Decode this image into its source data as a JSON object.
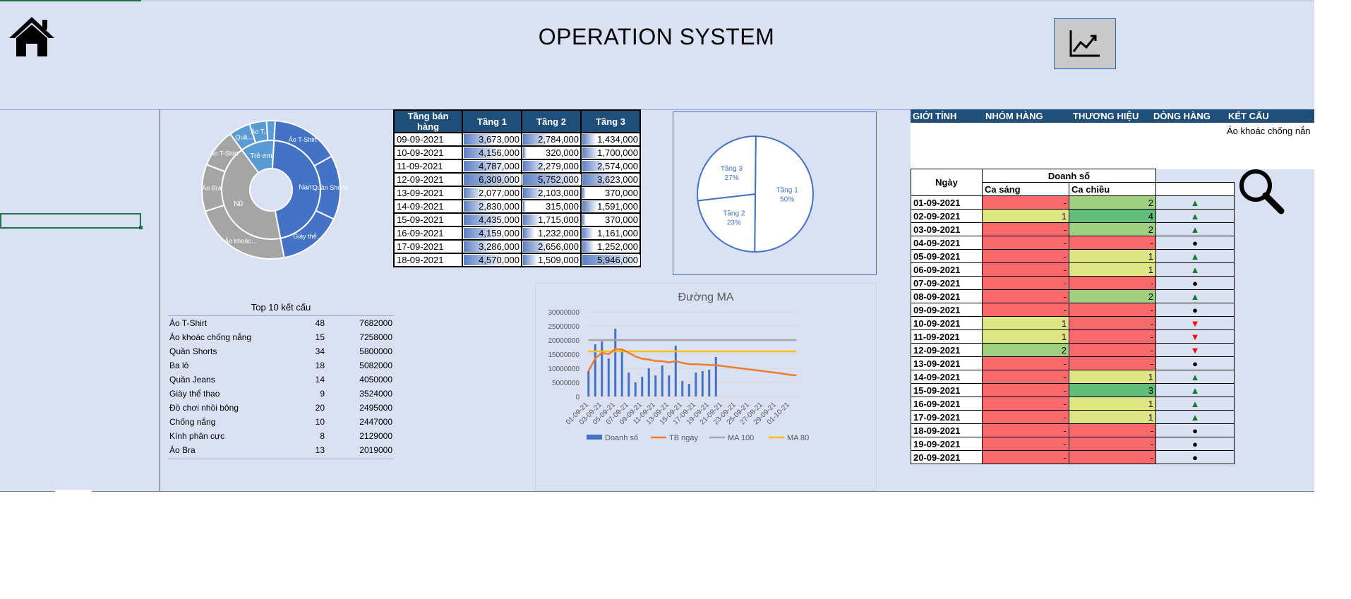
{
  "app": {
    "title": "OPERATION SYSTEM"
  },
  "icons": {
    "home": "home-icon",
    "chart": "chart-line-icon",
    "search": "search-icon"
  },
  "floor_table": {
    "headers": [
      "Tầng bán hàng",
      "Tầng 1",
      "Tầng 2",
      "Tầng 3"
    ],
    "rows": [
      {
        "date": "09-09-2021",
        "t1": "3,673,000",
        "t2": "2,784,000",
        "t3": "1,434,000",
        "f1": 0.58,
        "f2": 0.48,
        "f3": 0.24
      },
      {
        "date": "10-09-2021",
        "t1": "4,156,000",
        "t2": "320,000",
        "t3": "1,700,000",
        "f1": 0.66,
        "f2": 0.06,
        "f3": 0.29
      },
      {
        "date": "11-09-2021",
        "t1": "4,787,000",
        "t2": "2,279,000",
        "t3": "2,574,000",
        "f1": 0.76,
        "f2": 0.4,
        "f3": 0.43
      },
      {
        "date": "12-09-2021",
        "t1": "6,309,000",
        "t2": "5,752,000",
        "t3": "3,623,000",
        "f1": 1.0,
        "f2": 1.0,
        "f3": 0.61
      },
      {
        "date": "13-09-2021",
        "t1": "2,077,000",
        "t2": "2,103,000",
        "t3": "370,000",
        "f1": 0.33,
        "f2": 0.37,
        "f3": 0.06
      },
      {
        "date": "14-09-2021",
        "t1": "2,830,000",
        "t2": "315,000",
        "t3": "1,591,000",
        "f1": 0.45,
        "f2": 0.05,
        "f3": 0.27
      },
      {
        "date": "15-09-2021",
        "t1": "4,435,000",
        "t2": "1,715,000",
        "t3": "370,000",
        "f1": 0.7,
        "f2": 0.3,
        "f3": 0.06
      },
      {
        "date": "16-09-2021",
        "t1": "4,159,000",
        "t2": "1,232,000",
        "t3": "1,161,000",
        "f1": 0.66,
        "f2": 0.21,
        "f3": 0.2
      },
      {
        "date": "17-09-2021",
        "t1": "3,286,000",
        "t2": "2,656,000",
        "t3": "1,252,000",
        "f1": 0.52,
        "f2": 0.46,
        "f3": 0.21
      },
      {
        "date": "18-09-2021",
        "t1": "4,570,000",
        "t2": "1,509,000",
        "t3": "5,946,000",
        "f1": 0.72,
        "f2": 0.26,
        "f3": 1.0
      }
    ]
  },
  "filters": {
    "headers": [
      "GIỚI TÍNH",
      "NHÓM HÀNG",
      "THƯƠNG HIỆU",
      "DÒNG HÀNG",
      "KẾT CẤU"
    ],
    "value": "Áo khoác chống nắn"
  },
  "sales_table": {
    "date_header": "Ngày",
    "group_header": "Doanh số",
    "col1": "Ca sáng",
    "col2": "Ca chiều",
    "rows": [
      {
        "date": "01-09-2021",
        "a": "-",
        "b": "2",
        "ca": "red",
        "cb": "lgr",
        "trend": "▲",
        "tc": "up"
      },
      {
        "date": "02-09-2021",
        "a": "1",
        "b": "4",
        "ca": "yel",
        "cb": "grn",
        "trend": "▲",
        "tc": "up"
      },
      {
        "date": "03-09-2021",
        "a": "-",
        "b": "2",
        "ca": "red",
        "cb": "lgr",
        "trend": "▲",
        "tc": "up"
      },
      {
        "date": "04-09-2021",
        "a": "-",
        "b": "-",
        "ca": "red",
        "cb": "red",
        "trend": "●",
        "tc": "dot"
      },
      {
        "date": "05-09-2021",
        "a": "-",
        "b": "1",
        "ca": "red",
        "cb": "yel",
        "trend": "▲",
        "tc": "up"
      },
      {
        "date": "06-09-2021",
        "a": "-",
        "b": "1",
        "ca": "red",
        "cb": "yel",
        "trend": "▲",
        "tc": "up"
      },
      {
        "date": "07-09-2021",
        "a": "-",
        "b": "-",
        "ca": "red",
        "cb": "red",
        "trend": "●",
        "tc": "dot"
      },
      {
        "date": "08-09-2021",
        "a": "-",
        "b": "2",
        "ca": "red",
        "cb": "lgr",
        "trend": "▲",
        "tc": "up"
      },
      {
        "date": "09-09-2021",
        "a": "-",
        "b": "-",
        "ca": "red",
        "cb": "red",
        "trend": "●",
        "tc": "dot"
      },
      {
        "date": "10-09-2021",
        "a": "1",
        "b": "-",
        "ca": "yel",
        "cb": "red",
        "trend": "▼",
        "tc": "down"
      },
      {
        "date": "11-09-2021",
        "a": "1",
        "b": "-",
        "ca": "yel",
        "cb": "red",
        "trend": "▼",
        "tc": "down"
      },
      {
        "date": "12-09-2021",
        "a": "2",
        "b": "-",
        "ca": "lgr",
        "cb": "red",
        "trend": "▼",
        "tc": "down"
      },
      {
        "date": "13-09-2021",
        "a": "-",
        "b": "-",
        "ca": "red",
        "cb": "red",
        "trend": "●",
        "tc": "dot"
      },
      {
        "date": "14-09-2021",
        "a": "-",
        "b": "1",
        "ca": "red",
        "cb": "yel",
        "trend": "▲",
        "tc": "up"
      },
      {
        "date": "15-09-2021",
        "a": "-",
        "b": "3",
        "ca": "red",
        "cb": "grn",
        "trend": "▲",
        "tc": "up"
      },
      {
        "date": "16-09-2021",
        "a": "-",
        "b": "1",
        "ca": "red",
        "cb": "yel",
        "trend": "▲",
        "tc": "up"
      },
      {
        "date": "17-09-2021",
        "a": "-",
        "b": "1",
        "ca": "red",
        "cb": "yel",
        "trend": "▲",
        "tc": "up"
      },
      {
        "date": "18-09-2021",
        "a": "-",
        "b": "-",
        "ca": "red",
        "cb": "red",
        "trend": "●",
        "tc": "dot"
      },
      {
        "date": "19-09-2021",
        "a": "-",
        "b": "-",
        "ca": "red",
        "cb": "red",
        "trend": "●",
        "tc": "dot"
      },
      {
        "date": "20-09-2021",
        "a": "-",
        "b": "-",
        "ca": "red",
        "cb": "red",
        "trend": "●",
        "tc": "dot"
      }
    ]
  },
  "top10": {
    "title": "Top 10 kết cấu",
    "rows": [
      {
        "name": "Áo T-Shirt",
        "qty": "48",
        "sales": "7682000"
      },
      {
        "name": "Áo khoác chống nắng",
        "qty": "15",
        "sales": "7258000"
      },
      {
        "name": "Quần Shorts",
        "qty": "34",
        "sales": "5800000"
      },
      {
        "name": "Ba lô",
        "qty": "18",
        "sales": "5082000"
      },
      {
        "name": "Quần Jeans",
        "qty": "14",
        "sales": "4050000"
      },
      {
        "name": "Giày thể thao",
        "qty": "9",
        "sales": "3524000"
      },
      {
        "name": "Đồ chơi nhồi bông",
        "qty": "20",
        "sales": "2495000"
      },
      {
        "name": "Chống nắng",
        "qty": "10",
        "sales": "2447000"
      },
      {
        "name": "Kính phân cực",
        "qty": "8",
        "sales": "2129000"
      },
      {
        "name": "Áo Bra",
        "qty": "13",
        "sales": "2019000"
      }
    ]
  },
  "chart_data": [
    {
      "type": "sunburst",
      "inner": [
        {
          "label": "Nam",
          "value": 0.46,
          "color": "#4472c4"
        },
        {
          "label": "Nữ",
          "value": 0.43,
          "color": "#a5a5a5"
        },
        {
          "label": "Trẻ em",
          "value": 0.11,
          "color": "#5b9bd5"
        }
      ],
      "outer": [
        {
          "label": "Áo T-Shirt",
          "value": 0.16,
          "color": "#4472c4"
        },
        {
          "label": "Quần Shorts",
          "value": 0.15,
          "color": "#4472c4"
        },
        {
          "label": "Giày thể...",
          "value": 0.15,
          "color": "#4472c4"
        },
        {
          "label": "Áo khoác chống nắng",
          "value": 0.23,
          "color": "#a5a5a5"
        },
        {
          "label": "Áo Bra",
          "value": 0.11,
          "color": "#a5a5a5"
        },
        {
          "label": "Áo T-Shirt",
          "value": 0.09,
          "color": "#a5a5a5"
        },
        {
          "label": "Quầ...",
          "value": 0.05,
          "color": "#5b9bd5"
        },
        {
          "label": "Áo T...",
          "value": 0.04,
          "color": "#5b9bd5"
        },
        {
          "label": "",
          "value": 0.02,
          "color": "#5b9bd5"
        }
      ]
    },
    {
      "type": "pie",
      "slices": [
        {
          "label": "Tầng 1",
          "pct": "50%",
          "value": 50
        },
        {
          "label": "Tầng 2",
          "pct": "23%",
          "value": 23
        },
        {
          "label": "Tầng 3",
          "pct": "27%",
          "value": 27
        }
      ]
    },
    {
      "type": "bar+line",
      "title": "Đường MA",
      "ylim": [
        0,
        30000000
      ],
      "yticks": [
        "30000000",
        "25000000",
        "20000000",
        "15000000",
        "10000000",
        "5000000",
        "0"
      ],
      "xticks": [
        "01-09-21",
        "03-09-21",
        "05-09-21",
        "07-09-21",
        "09-09-21",
        "11-09-21",
        "13-09-21",
        "15-09-21",
        "17-09-21",
        "19-09-21",
        "21-09-21",
        "23-09-21",
        "25-09-21",
        "27-09-21",
        "29-09-21",
        "01-10-21"
      ],
      "bars": [
        9000000,
        18500000,
        19500000,
        13500000,
        24000000,
        16500000,
        8500000,
        5000000,
        7000000,
        10000000,
        7500000,
        11000000,
        7500000,
        18000000,
        5500000,
        4500000,
        8500000,
        9000000,
        9500000,
        14000000
      ],
      "tb_ngay": [
        9000000,
        13500000,
        15500000,
        15000000,
        16800000,
        16700000,
        15500000,
        14200000,
        13400000,
        13100000,
        12600000,
        12500000,
        12100000,
        12500000,
        11900000,
        11500000,
        11400000,
        11300000,
        11200000,
        11100000,
        10800000,
        10500000,
        10200000,
        9900000,
        9600000,
        9300000,
        9000000,
        8700000,
        8400000,
        8100000,
        7700000,
        7500000
      ],
      "ma100": 20000000,
      "ma80": 16000000,
      "legend": [
        "Doanh số",
        "TB ngày",
        "MA 100",
        "MA 80"
      ],
      "colors": {
        "bars": "#4472c4",
        "tb": "#ed7d31",
        "ma100": "#a5a5a5",
        "ma80": "#ffc000"
      }
    }
  ]
}
